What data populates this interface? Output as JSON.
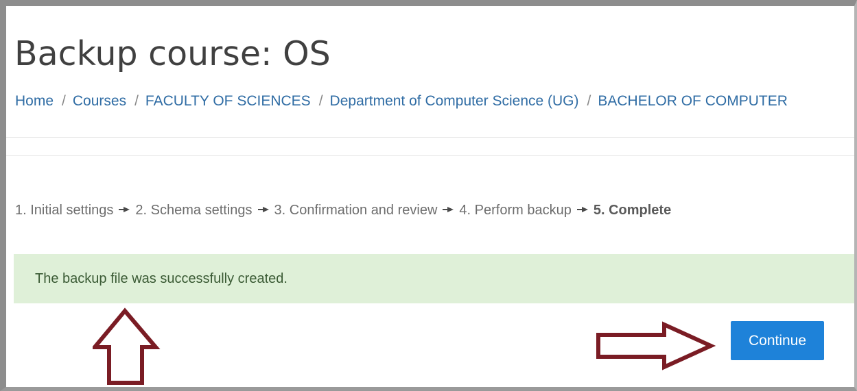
{
  "page": {
    "title": "Backup course: OS"
  },
  "breadcrumb": [
    {
      "label": "Home"
    },
    {
      "label": "Courses"
    },
    {
      "label": "FACULTY OF SCIENCES"
    },
    {
      "label": "Department of Computer Science (UG)"
    },
    {
      "label": "BACHELOR OF COMPUTER"
    }
  ],
  "breadcrumb_separator": "/",
  "steps": [
    {
      "label": "1. Initial settings"
    },
    {
      "label": "2. Schema settings"
    },
    {
      "label": "3. Confirmation and review"
    },
    {
      "label": "4. Perform backup"
    },
    {
      "label": "5. Complete",
      "current": true
    }
  ],
  "alert": {
    "message": "The backup file was successfully created."
  },
  "actions": {
    "continue_label": "Continue"
  },
  "colors": {
    "link": "#2f6ca4",
    "alert_background": "#dff0d8",
    "primary_button": "#1e82d9",
    "annotation_arrow": "#7a1c24"
  }
}
